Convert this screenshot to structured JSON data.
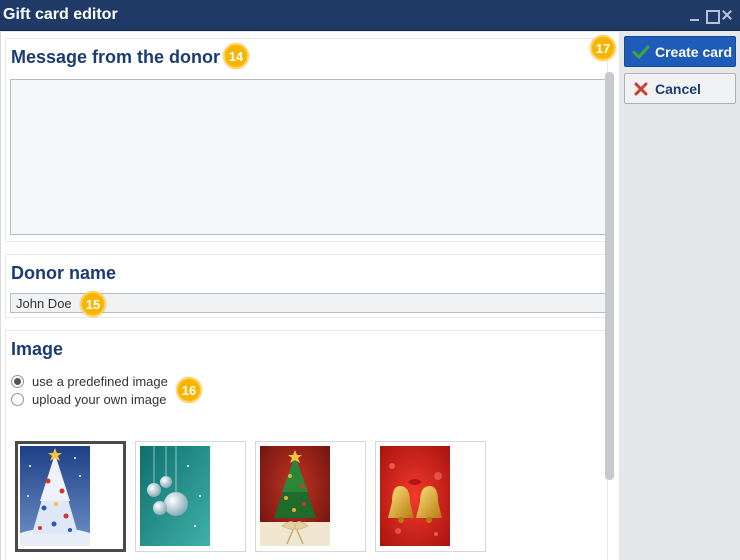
{
  "window": {
    "title": "Gift card editor"
  },
  "message_section": {
    "title": "Message from the donor",
    "value": ""
  },
  "donor_section": {
    "title": "Donor name",
    "value": "John Doe"
  },
  "image_section": {
    "title": "Image",
    "options": [
      {
        "label": "use a predefined image",
        "selected": true
      },
      {
        "label": "upload your own image",
        "selected": false
      }
    ],
    "selected_thumbnail": 1
  },
  "actions": {
    "create_label": "Create card",
    "cancel_label": "Cancel"
  },
  "callouts": {
    "message": "14",
    "donor": "15",
    "image": "16",
    "actions": "17"
  },
  "colors": {
    "titlebar": "#1f3a66",
    "heading": "#1a3c73",
    "primary_button": "#1f5bb8",
    "callout": "#f7b500",
    "check": "#3fa73a",
    "cancel_x": "#d23b32"
  },
  "icons": {
    "create": "checkmark-icon",
    "cancel": "x-icon"
  }
}
